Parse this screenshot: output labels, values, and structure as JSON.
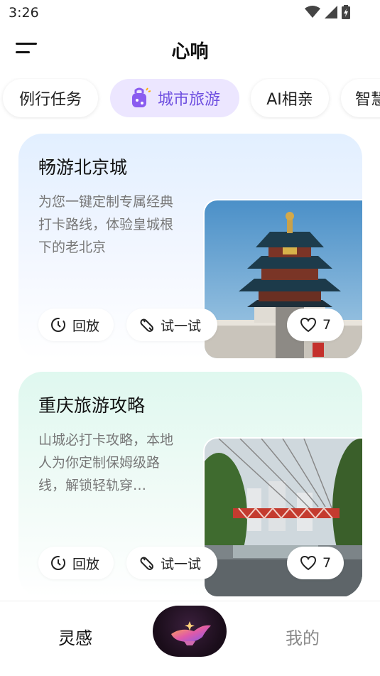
{
  "status_bar": {
    "time": "3:26"
  },
  "header": {
    "title": "心响"
  },
  "tabs": [
    {
      "label": "例行任务"
    },
    {
      "label": "城市旅游",
      "active": true
    },
    {
      "label": "AI相亲"
    },
    {
      "label": "智慧"
    }
  ],
  "cards": [
    {
      "title": "畅游北京城",
      "description": "为您一键定制专属经典打卡路线，体验皇城根下的老北京",
      "replay_label": "回放",
      "try_label": "试一试",
      "likes": "7"
    },
    {
      "title": "重庆旅游攻略",
      "description": "山城必打卡攻略，本地人为你定制保姆级路线，解锁轻轨穿…",
      "replay_label": "回放",
      "try_label": "试一试",
      "likes": "7"
    }
  ],
  "bottom_nav": {
    "left_label": "灵感",
    "right_label": "我的"
  },
  "colors": {
    "accent": "#6e4fe0",
    "active_tab_bg": "#ece6ff"
  }
}
